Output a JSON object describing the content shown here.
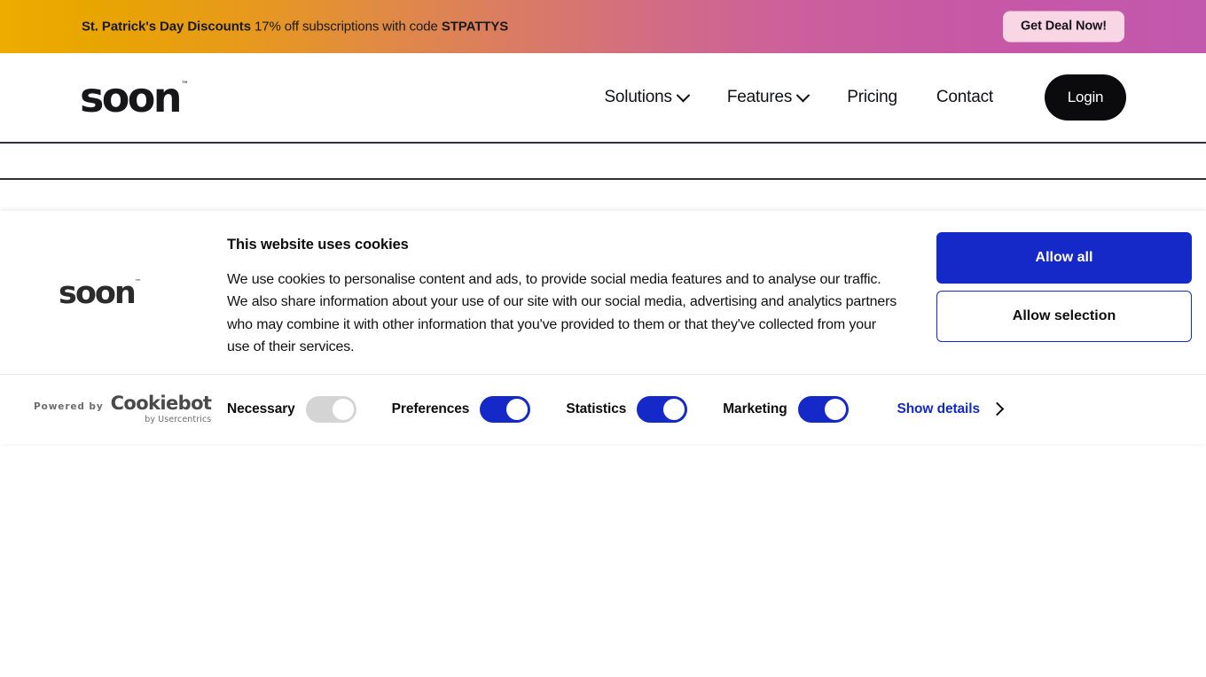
{
  "promo": {
    "bold_lead": "St. Patrick's Day Discounts",
    "middle": " 17% off subscriptions with code ",
    "code": "STPATTYS",
    "cta_label": "Get Deal Now!",
    "gradient_start": "#eeac00",
    "gradient_end": "#c259ad",
    "cta_bg": "#f9d6e4"
  },
  "header": {
    "logo_text": "soon",
    "logo_tm": "™",
    "nav": [
      {
        "label": "Solutions",
        "has_dropdown": true,
        "icon": "chevron-down-icon"
      },
      {
        "label": "Features",
        "has_dropdown": true,
        "icon": "chevron-down-icon"
      },
      {
        "label": "Pricing",
        "has_dropdown": false
      },
      {
        "label": "Contact",
        "has_dropdown": false
      }
    ],
    "login_label": "Login",
    "login_bg": "#0b0b0d"
  },
  "cookie": {
    "logo_text": "soon",
    "logo_tm": "™",
    "heading": "This website uses cookies",
    "paragraph": "We use cookies to personalise content and ads, to provide social media features and to analyse our traffic. We also share information about your use of our site with our social media, advertising and analytics partners who may combine it with other information that you've provided to them or that they've collected from your use of their services.",
    "allow_all_label": "Allow all",
    "allow_selection_label": "Allow selection",
    "accent_color": "#1528c8",
    "powered_by_label": "Powered by",
    "powered_by_brand": "Cookiebot",
    "powered_by_sub": "by Usercentrics",
    "toggles": [
      {
        "label": "Necessary",
        "state": "locked-on"
      },
      {
        "label": "Preferences",
        "state": "on"
      },
      {
        "label": "Statistics",
        "state": "on"
      },
      {
        "label": "Marketing",
        "state": "on"
      }
    ],
    "show_details_label": "Show details",
    "show_details_icon": "chevron-right-icon"
  }
}
